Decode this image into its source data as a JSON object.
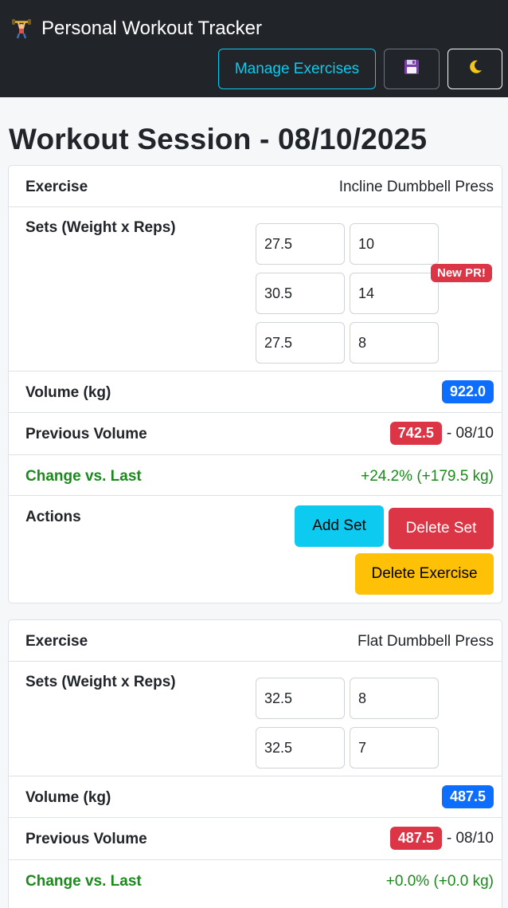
{
  "navbar": {
    "title": "Personal Workout Tracker",
    "brand_icon": "weightlifter-icon",
    "manage_label": "Manage Exercises",
    "save_icon": "floppy-disk-icon",
    "theme_icon": "moon-icon"
  },
  "page": {
    "title": "Workout Session - 08/10/2025"
  },
  "labels": {
    "exercise": "Exercise",
    "sets": "Sets (Weight x Reps)",
    "volume": "Volume (kg)",
    "previous": "Previous Volume",
    "change": "Change vs. Last",
    "actions": "Actions",
    "add_set": "Add Set",
    "delete_set": "Delete Set",
    "delete_exercise": "Delete Exercise",
    "pr_badge": "New PR!"
  },
  "exercises": [
    {
      "name": "Incline Dumbbell Press",
      "sets": [
        {
          "weight": "27.5",
          "reps": "10"
        },
        {
          "weight": "30.5",
          "reps": "14"
        },
        {
          "weight": "27.5",
          "reps": "8"
        }
      ],
      "volume": "922.0",
      "previous_volume": "742.5",
      "previous_date": "- 08/10",
      "change": "+24.2% (+179.5 kg)"
    },
    {
      "name": "Flat Dumbbell Press",
      "sets": [
        {
          "weight": "32.5",
          "reps": "8"
        },
        {
          "weight": "32.5",
          "reps": "7"
        }
      ],
      "volume": "487.5",
      "previous_volume": "487.5",
      "previous_date": "- 08/10",
      "change": "+0.0% (+0.0 kg)"
    }
  ],
  "colors": {
    "navbar_bg": "#212529",
    "info": "#0dcaf0",
    "danger": "#dc3545",
    "primary": "#0d6efd",
    "warning": "#ffc107",
    "success_text": "#1a8a1a"
  }
}
